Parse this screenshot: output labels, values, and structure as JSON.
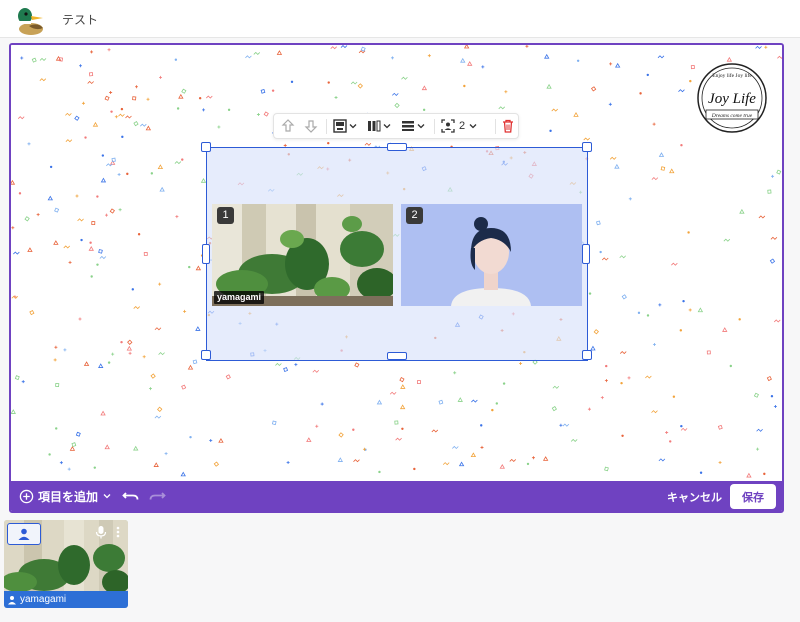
{
  "header": {
    "title": "テスト"
  },
  "badge": {
    "top_text": "Enjoy life Joy life",
    "main_text": "Joy Life",
    "bottom_text": "Dreams come true"
  },
  "toolbar": {
    "participants_count": "2"
  },
  "tiles": [
    {
      "number": "1",
      "name": "yamagami"
    },
    {
      "number": "2"
    }
  ],
  "bottombar": {
    "add_label": "項目を追加",
    "cancel_label": "キャンセル",
    "save_label": "保存"
  },
  "participant": {
    "name": "yamagami"
  },
  "colors": {
    "accent": "#6f42c1",
    "selection": "#2d5bd6",
    "tile_bg": "#aebff2",
    "name_bar": "#2d6fd6"
  }
}
